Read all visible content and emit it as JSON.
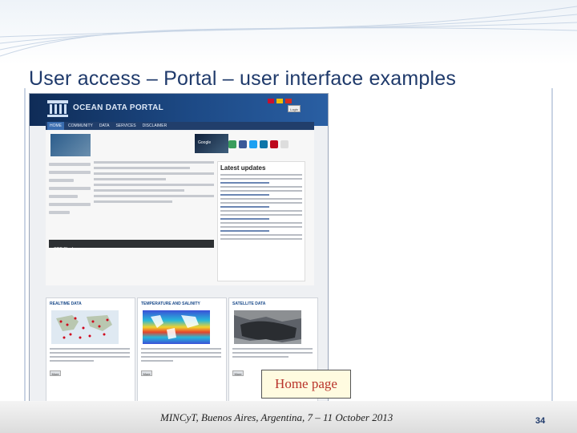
{
  "slide": {
    "title": "User access – Portal – user interface examples",
    "footer": "MINCyT, Buenos Aires, Argentina, 7 – 11 October 2013",
    "page_number": "34",
    "callout": "Home page"
  },
  "portal": {
    "name": "OCEAN DATA PORTAL",
    "login_label": "Login",
    "nav": [
      "HOME",
      "COMMUNITY",
      "DATA",
      "SERVICES",
      "DISCLAIMER"
    ],
    "banner_text": "Google",
    "latest_updates_title": "Latest updates",
    "dark_strip_text": "ODP Charleswave",
    "cards": [
      {
        "title": "REALTIME DATA",
        "more": "More"
      },
      {
        "title": "TEMPERATURE AND SALINITY",
        "more": "More"
      },
      {
        "title": "SATELLITE DATA",
        "more": "More"
      }
    ]
  },
  "colors": {
    "header": "#1d4a86",
    "title": "#1f3a6b",
    "callout_text": "#b8332a"
  }
}
